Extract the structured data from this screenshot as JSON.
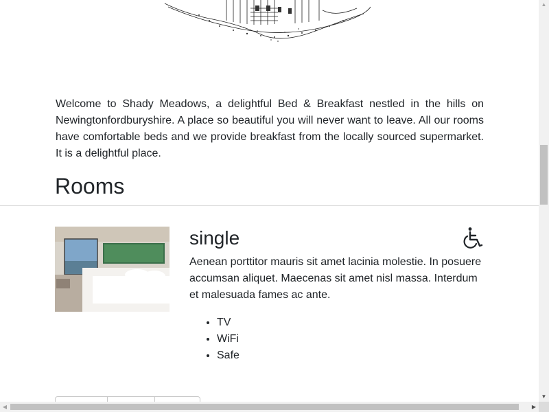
{
  "intro": {
    "text": "Welcome to Shady Meadows, a delightful Bed & Breakfast nestled in the hills on Newingtonfordburyshire. A place so beautiful you will never want to leave. All our rooms have comfortable beds and we provide breakfast from the locally sourced supermarket. It is a delightful place."
  },
  "rooms_heading": "Rooms",
  "room": {
    "name": "single",
    "accessible_icon": "wheelchair-icon",
    "description": "Aenean porttitor mauris sit amet lacinia molestie. In posuere accumsan aliquet. Maecenas sit amet nisl massa. Interdum et malesuada fames ac ante.",
    "features": [
      "TV",
      "WiFi",
      "Safe"
    ]
  },
  "scrollbars": {
    "up_glyph": "▲",
    "down_glyph": "▼",
    "left_glyph": "◀",
    "right_glyph": "▶"
  }
}
